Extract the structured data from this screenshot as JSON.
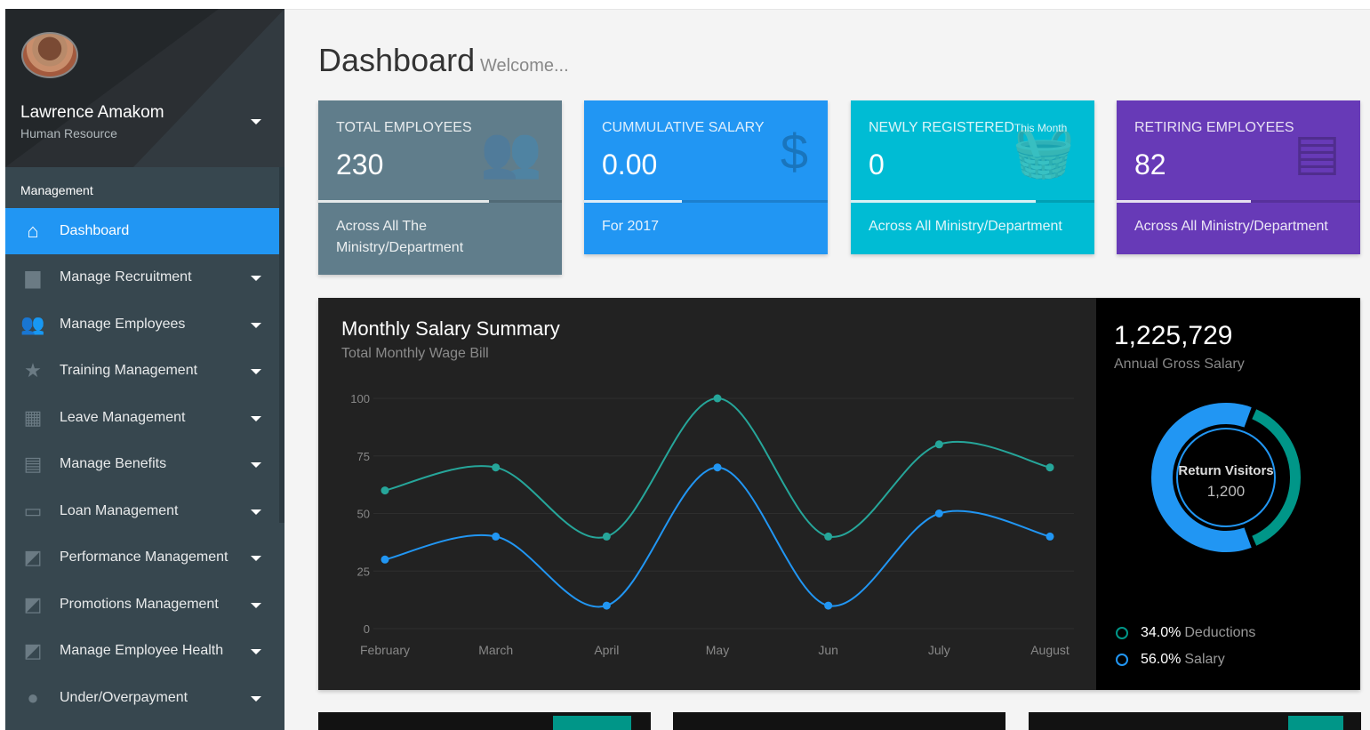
{
  "sidebar": {
    "user_name": "Lawrence Amakom",
    "user_role": "Human Resource",
    "section": "Management",
    "items": [
      {
        "label": "Dashboard",
        "icon": "home-icon",
        "glyph": "⌂"
      },
      {
        "label": "Manage Recruitment",
        "icon": "briefcase-icon",
        "glyph": "▆"
      },
      {
        "label": "Manage Employees",
        "icon": "people-icon",
        "glyph": "👥"
      },
      {
        "label": "Training Management",
        "icon": "star-icon",
        "glyph": "★"
      },
      {
        "label": "Leave Management",
        "icon": "calendar-icon",
        "glyph": "▦"
      },
      {
        "label": "Manage Benefits",
        "icon": "gift-icon",
        "glyph": "▤"
      },
      {
        "label": "Loan Management",
        "icon": "credit-card-icon",
        "glyph": "▭"
      },
      {
        "label": "Performance Management",
        "icon": "chart-edit-icon",
        "glyph": "◩"
      },
      {
        "label": "Promotions Management",
        "icon": "chart-edit-icon",
        "glyph": "◩"
      },
      {
        "label": "Manage Employee Health",
        "icon": "chart-edit-icon",
        "glyph": "◩"
      },
      {
        "label": "Under/Overpayment",
        "icon": "alert-icon",
        "glyph": "●"
      }
    ]
  },
  "header": {
    "title": "Dashboard",
    "subtitle": "Welcome..."
  },
  "cards": [
    {
      "title": "TOTAL EMPLOYEES",
      "title_suffix": "",
      "value": "230",
      "footer": "Across All The Ministry/Department",
      "color": "#607d8b",
      "icon": "people-icon",
      "glyph": "👥",
      "progress": 0.7
    },
    {
      "title": "CUMMULATIVE SALARY",
      "title_suffix": "",
      "value": "0.00",
      "footer": "For 2017",
      "color": "#2196f3",
      "icon": "dollar-icon",
      "glyph": "$",
      "progress": 0.4
    },
    {
      "title": "NEWLY REGISTERED",
      "title_suffix": "This Month",
      "value": "0",
      "footer": "Across All Ministry/Department",
      "color": "#00bcd4",
      "icon": "basket-icon",
      "glyph": "🧺",
      "progress": 0.76
    },
    {
      "title": "RETIRING EMPLOYEES",
      "title_suffix": "",
      "value": "82",
      "footer": "Across All Ministry/Department",
      "color": "#673ab7",
      "icon": "comment-icon",
      "glyph": "▤",
      "progress": 0.55
    }
  ],
  "chart_panel": {
    "annual_value": "1,225,729",
    "annual_label": "Annual Gross Salary",
    "donut_label": "Return Visitors",
    "donut_value": "1,200",
    "legend": [
      {
        "value": "34.0%",
        "label": "Deductions",
        "color": "#009688"
      },
      {
        "value": "56.0%",
        "label": "Salary",
        "color": "#2196f3"
      }
    ]
  },
  "chart_data": {
    "type": "line",
    "title": "Monthly Salary Summary",
    "subtitle": "Total Monthly Wage Bill",
    "categories": [
      "February",
      "March",
      "April",
      "May",
      "Jun",
      "July",
      "August"
    ],
    "yticks": [
      "0",
      "25",
      "50",
      "75",
      "100"
    ],
    "ylim": [
      0,
      100
    ],
    "series": [
      {
        "values": [
          60,
          70,
          40,
          100,
          40,
          80,
          70
        ],
        "color": "#26a69a"
      },
      {
        "values": [
          30,
          40,
          10,
          70,
          10,
          50,
          40
        ],
        "color": "#2196f3"
      }
    ],
    "donut": [
      {
        "label": "Deductions",
        "value": 34.0,
        "color": "#009688"
      },
      {
        "label": "Salary",
        "value": 56.0,
        "color": "#2196f3"
      }
    ]
  }
}
